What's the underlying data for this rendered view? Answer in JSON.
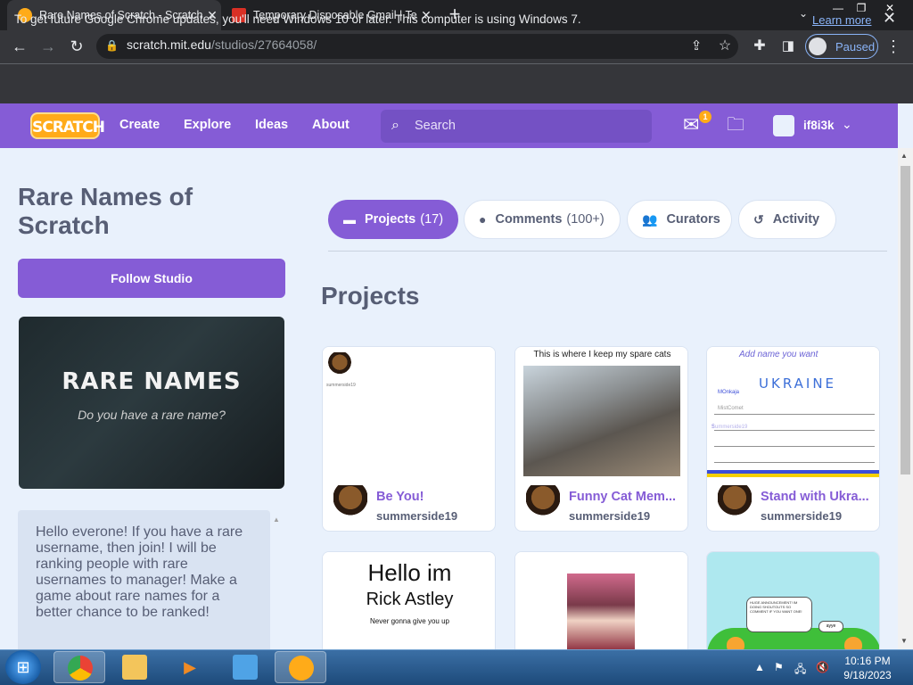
{
  "browser": {
    "tabs": [
      {
        "title": "Rare Names of Scratch - Scratch",
        "active": true,
        "favicon_color": "#ffab19"
      },
      {
        "title": "Temporary Disposable Gmail | Te",
        "active": false,
        "favicon_color": "#d93025"
      }
    ],
    "new_tab_symbol": "+",
    "window_controls": {
      "minimize": "—",
      "restore": "❐",
      "close": "✕"
    },
    "url_host": "scratch.mit.edu",
    "url_path": "/studios/27664058/",
    "profile_label": "Paused",
    "infobar": {
      "message": "To get future Google Chrome updates, you'll need Windows 10 or later. This computer is using Windows 7.",
      "link": "Learn more",
      "close": "✕"
    }
  },
  "nav": {
    "logo_text": "SCRATCH",
    "links": [
      "Create",
      "Explore",
      "Ideas",
      "About"
    ],
    "search_placeholder": "Search",
    "messages_count": "1",
    "username": "if8i3k",
    "brand_color": "#855cd6"
  },
  "studio": {
    "title": "Rare Names of Scratch",
    "follow_label": "Follow Studio",
    "thumbnail": {
      "headline": "RARE NAMES",
      "subline": "Do you have a rare name?"
    },
    "description": "Hello everone! If you have a rare username, then join! I will be ranking people with rare usernames to manager! Make a game about rare names for a better chance to be ranked!"
  },
  "tabs": [
    {
      "label": "Projects",
      "count": "(17)",
      "icon": "projects-icon",
      "active": true
    },
    {
      "label": "Comments",
      "count": "(100+)",
      "icon": "comment-icon",
      "active": false
    },
    {
      "label": "Curators",
      "count": "",
      "icon": "curators-icon",
      "active": false
    },
    {
      "label": "Activity",
      "count": "",
      "icon": "activity-icon",
      "active": false
    }
  ],
  "projects_heading": "Projects",
  "projects": [
    {
      "title": "Be You!",
      "author": "summerside19",
      "thumb_text": "summerside19"
    },
    {
      "title": "Funny Cat Mem...",
      "author": "summerside19",
      "thumb_text": "This is where I keep my spare cats"
    },
    {
      "title": "Stand with Ukra...",
      "author": "summerside19",
      "thumb_text": "Add name you want",
      "thumb_words": [
        "UKRAINE",
        "MOnkaja",
        "MistComet",
        "Summerside19"
      ]
    },
    {
      "title": "",
      "author": "",
      "thumb_line1": "Hello im",
      "thumb_line2": "Rick Astley",
      "thumb_line3": "Never gonna give you up"
    },
    {
      "title": "",
      "author": "",
      "thumb_text": ""
    },
    {
      "title": "",
      "author": "",
      "thumb_bubble": "HUGE ANNOUNCEMENT! IM DOING SHOUTOUTS SO COMMENT IF YOU WANT ONE!",
      "thumb_reply": "ayye"
    }
  ],
  "taskbar": {
    "time": "10:16 PM",
    "date": "9/18/2023",
    "apps": [
      "chrome",
      "explorer",
      "media-player",
      "remote-desktop",
      "scratch"
    ]
  }
}
